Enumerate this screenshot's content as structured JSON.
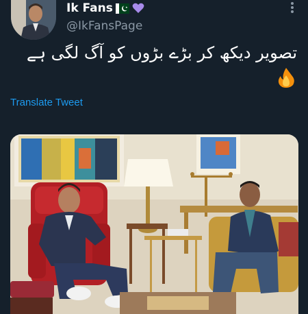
{
  "tweet": {
    "author_name": "Ik Fans",
    "author_handle": "@IkFansPage",
    "text": "تصویر دیکھ کر بڑے بڑوں کو آگ لگی ہے",
    "translate_label": "Translate Tweet"
  },
  "icons": {
    "flag": "pakistan-flag-icon",
    "heart": "purple-heart-icon",
    "fire": "fire-emoji-icon",
    "more": "more-options-icon"
  },
  "colors": {
    "background": "#15202b",
    "link": "#1d9bf0",
    "secondary_text": "#8b98a5",
    "heart": "#a88beb"
  }
}
